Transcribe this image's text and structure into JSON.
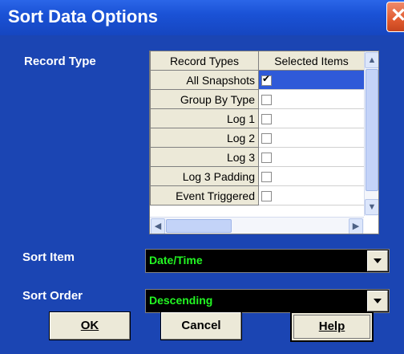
{
  "window": {
    "title": "Sort Data Options",
    "close_icon": "close-icon"
  },
  "labels": {
    "record_type": "Record Type",
    "sort_item": "Sort Item",
    "sort_order": "Sort Order"
  },
  "grid": {
    "columns": [
      "Record Types",
      "Selected Items"
    ],
    "rows": [
      {
        "label": "All Snapshots",
        "checked": true
      },
      {
        "label": "Group By Type",
        "checked": false
      },
      {
        "label": "Log 1",
        "checked": false
      },
      {
        "label": "Log 2",
        "checked": false
      },
      {
        "label": "Log 3",
        "checked": false
      },
      {
        "label": "Log 3 Padding",
        "checked": false
      },
      {
        "label": "Event Triggered",
        "checked": false
      }
    ]
  },
  "sort_item": {
    "value": "Date/Time"
  },
  "sort_order": {
    "value": "Descending"
  },
  "buttons": {
    "ok": "OK",
    "cancel": "Cancel",
    "help": "Help"
  },
  "colors": {
    "background": "#1b45b3",
    "combo_text": "#23f723",
    "selected_cell": "#2f5ad8"
  }
}
